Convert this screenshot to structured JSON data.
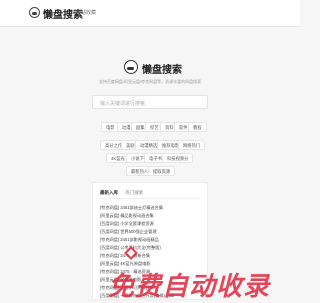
{
  "header": {
    "brand": "懒盘搜索",
    "nav_link": "网站收藏"
  },
  "hero": {
    "title": "懒盘搜索",
    "subtitle": "支持百度网盘/阿里云盘/夸克网盘等，资源丰富的网盘搜索",
    "search_placeholder": "输入关键词进行搜索"
  },
  "tags": [
    "电影",
    "动漫",
    "剧集",
    "综艺",
    "资料",
    "软件",
    "教程",
    "高分之作",
    "美剧",
    "动漫精选",
    "推荐电影",
    "网络热门",
    "4K蓝光",
    "小说下",
    "电子书",
    "科技视频分",
    "最新热人",
    "提取资源"
  ],
  "card": {
    "tab_active": "最新入库",
    "tab_other": "热门搜索",
    "items": [
      "[夸克网盘] 3451部迪士尼精选合集",
      "[阿里云盘] 精品影视动画合集",
      "[百度网盘] 小学全套课程资源",
      "[百度网盘] 世界500强企业管理",
      "[夸克网盘] 3451部影视动画精品",
      "[百度网盘] 公考资料大全(完整版)",
      "[夸克网盘] 3478 · 最新合集",
      "[阿里云盘] 4K蓝光原盘电影",
      "[夸克网盘] 3475 · 精选资源",
      "[阿里云盘] 经典老电影",
      "[夸克网盘] 全套学习资料合集",
      "[百度网盘] 一套教你自己开店(实操) · pdf"
    ]
  },
  "watermark": {
    "text": "免费自动收录"
  },
  "colors": {
    "background": "#f6f6f6",
    "watermark": "#dc283c"
  }
}
